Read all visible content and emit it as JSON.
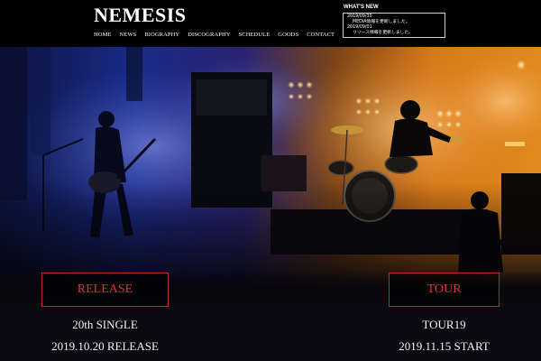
{
  "site": {
    "logo": "NEMESIS"
  },
  "nav": {
    "items": [
      "HOME",
      "NEWS",
      "BIOGRAPHY",
      "DISCOGRAPHY",
      "SCHEDULE",
      "GOODS",
      "CONTACT"
    ]
  },
  "whats_new": {
    "title": "WHAT'S NEW",
    "items": [
      {
        "date": "2019/09/30",
        "text": "MEDIA情報を更新しました。"
      },
      {
        "date": "2019/09/01",
        "text": "リリース情報を更新しました。"
      }
    ]
  },
  "hero": {
    "image": "live-concert-stage-photo"
  },
  "release": {
    "button_label": "RELEASE",
    "line1": "20th SINGLE",
    "line2": "2019.10.20 RELEASE"
  },
  "tour": {
    "button_label": "TOUR",
    "line1": "TOUR19",
    "line2": "2019.11.15 START"
  },
  "colors": {
    "accent_red": "#e3323a",
    "border_red": "#c3262d",
    "header_bg": "#000000"
  }
}
